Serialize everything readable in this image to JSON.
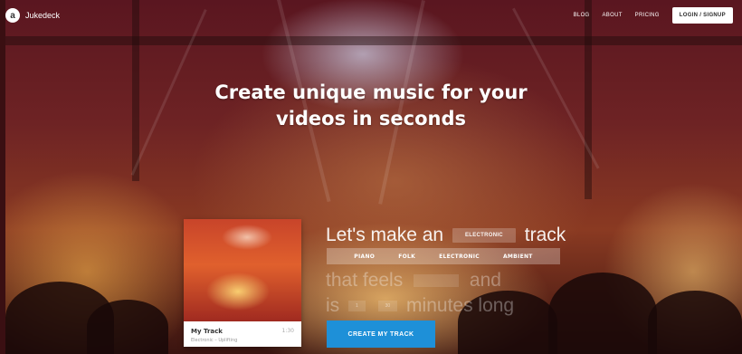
{
  "brand": {
    "logo_glyph": "a",
    "name": "Jukedeck"
  },
  "nav": {
    "blog": "BLOG",
    "about": "ABOUT",
    "pricing": "PRICING",
    "login": "LOGIN / SIGNUP"
  },
  "hero": {
    "headline_line1": "Create unique music for your",
    "headline_line2": "videos in seconds"
  },
  "card": {
    "title": "My Track",
    "subtitle": "Electronic – Uplifting",
    "duration": "1:30"
  },
  "builder": {
    "line1_prefix": "Let's make an",
    "selected_genre": "ELECTRONIC",
    "line1_suffix": "track",
    "genres": [
      "PIANO",
      "FOLK",
      "ELECTRONIC",
      "AMBIENT"
    ],
    "line2_prefix": "that feels",
    "line2_suffix": "and",
    "line3_prefix": "is",
    "minutes_value": "1",
    "seconds_value": "30",
    "line3_suffix": "minutes long"
  },
  "cta": {
    "label": "CREATE MY TRACK"
  },
  "colors": {
    "cta": "#1e90d8",
    "card_bg": "#ffffff"
  }
}
